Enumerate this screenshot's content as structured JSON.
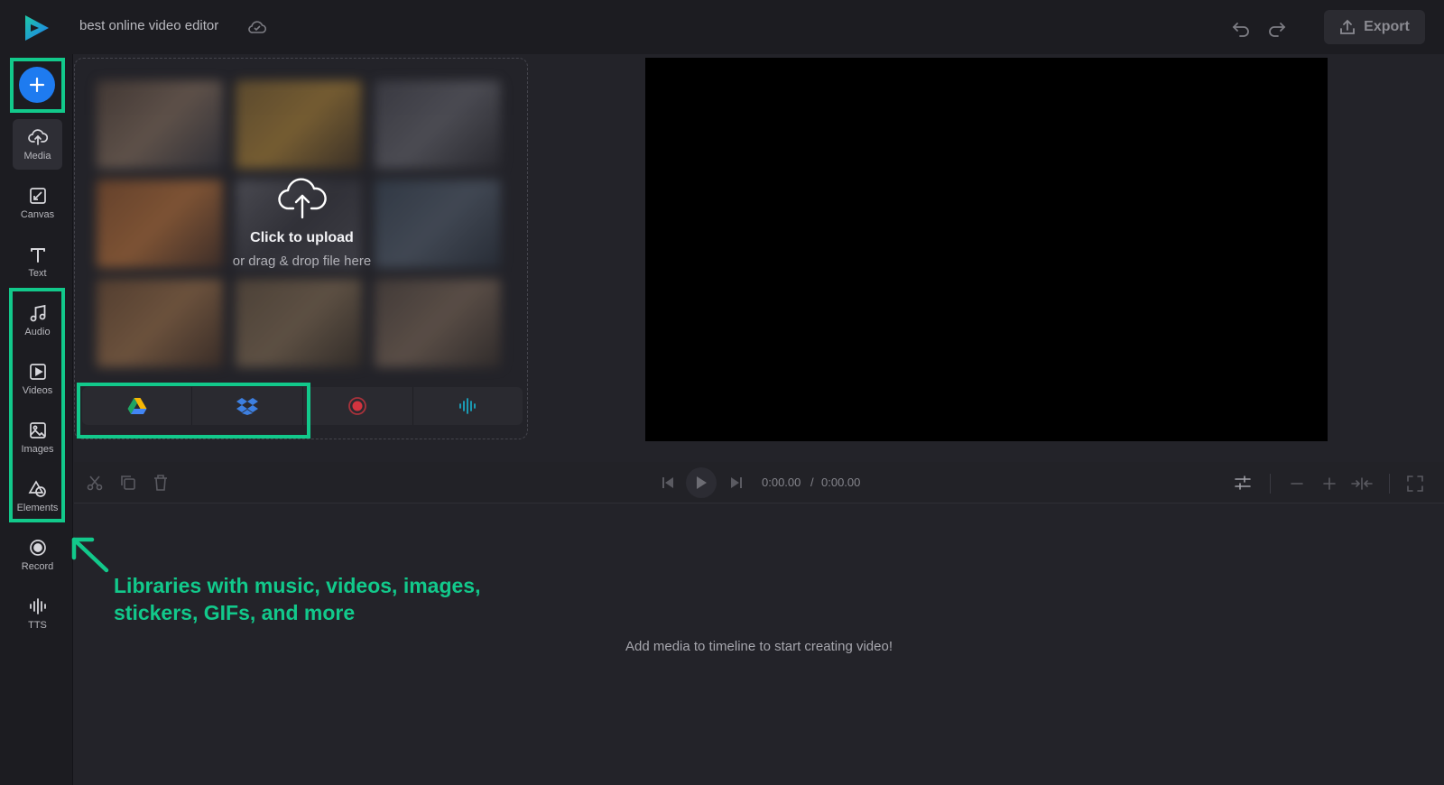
{
  "header": {
    "project_title": "best online video editor",
    "export_label": "Export"
  },
  "sidebar": {
    "items": [
      {
        "id": "media",
        "label": "Media",
        "icon": "upload-cloud-icon",
        "active": true
      },
      {
        "id": "canvas",
        "label": "Canvas",
        "icon": "canvas-icon"
      },
      {
        "id": "text",
        "label": "Text",
        "icon": "text-icon"
      },
      {
        "id": "audio",
        "label": "Audio",
        "icon": "music-note-icon"
      },
      {
        "id": "videos",
        "label": "Videos",
        "icon": "play-square-icon"
      },
      {
        "id": "images",
        "label": "Images",
        "icon": "image-icon"
      },
      {
        "id": "elements",
        "label": "Elements",
        "icon": "shapes-icon"
      },
      {
        "id": "record",
        "label": "Record",
        "icon": "record-icon"
      },
      {
        "id": "tts",
        "label": "TTS",
        "icon": "waveform-icon"
      }
    ]
  },
  "upload": {
    "title": "Click to upload",
    "subtitle": "or drag & drop file here",
    "sources": [
      "google-drive-icon",
      "dropbox-icon",
      "record-icon",
      "waveform-icon"
    ]
  },
  "timeline": {
    "current_time": "0:00.00",
    "separator": "/",
    "total_time": "0:00.00",
    "empty_message": "Add media to timeline to start creating video!"
  },
  "annotation": {
    "text": "Libraries with music, videos, images, stickers, GIFs, and more"
  },
  "colors": {
    "accent": "#1e7bf0",
    "highlight": "#12c98b",
    "background": "#232329",
    "sidebar": "#1c1c21"
  }
}
